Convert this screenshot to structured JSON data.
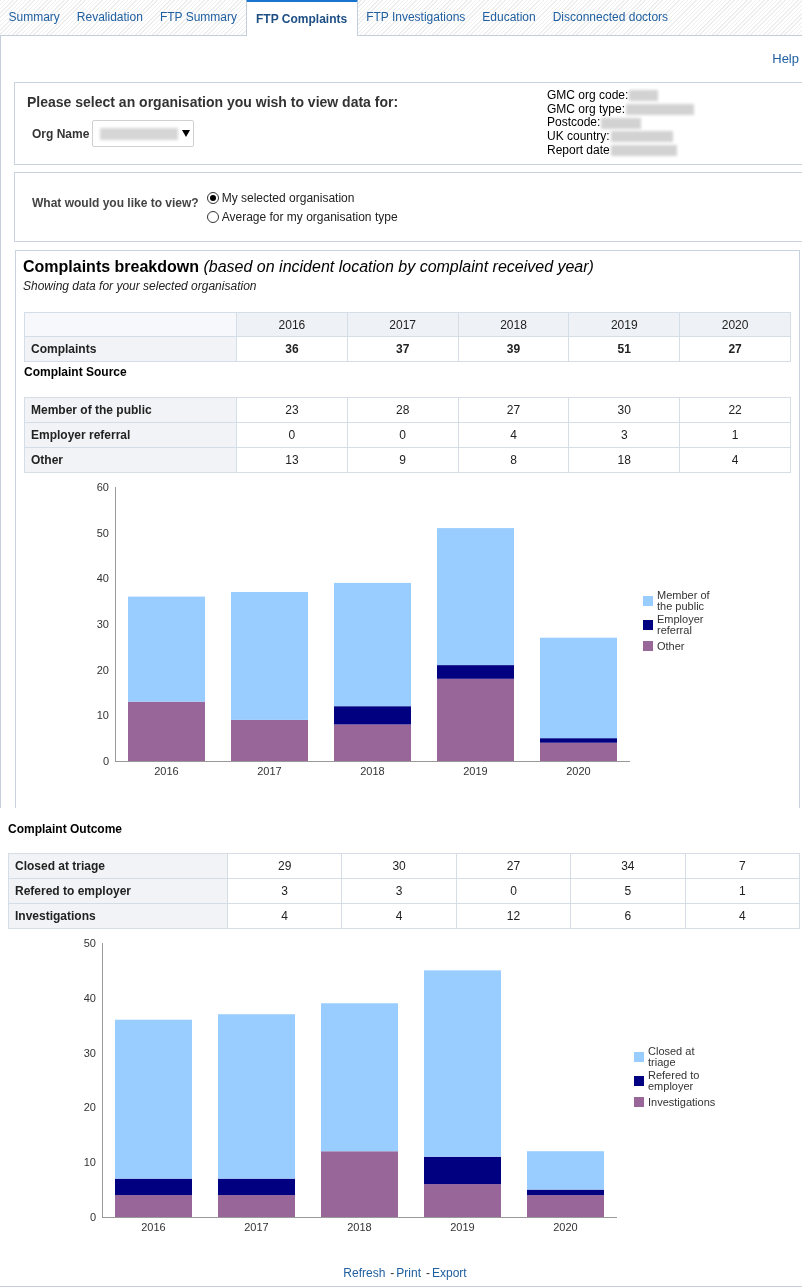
{
  "tabs": [
    {
      "label": "Summary",
      "selected": false
    },
    {
      "label": "Revalidation",
      "selected": false
    },
    {
      "label": "FTP Summary",
      "selected": false
    },
    {
      "label": "FTP Complaints",
      "selected": true
    },
    {
      "label": "FTP Investigations",
      "selected": false
    },
    {
      "label": "Education",
      "selected": false
    },
    {
      "label": "Disconnected doctors",
      "selected": false
    }
  ],
  "help_link": "Help",
  "organisation": {
    "prompt": "Please select an organisation you wish to view data for:",
    "org_name_label": "Org Name",
    "details": [
      "GMC org code:",
      "GMC org type:",
      "Postcode:",
      "UK country:",
      "Report date"
    ]
  },
  "view_selection": {
    "question": "What would you like to view?",
    "options": [
      {
        "label": "My selected organisation",
        "selected": true
      },
      {
        "label": "Average for my organisation type",
        "selected": false
      }
    ]
  },
  "complaints_breakdown": {
    "title": "**Complaints breakdown** *(based on incident location by complaint received year)*",
    "subtitle": "Showing data for your selected organisation",
    "years": [
      "2016",
      "2017",
      "2018",
      "2019",
      "2020"
    ],
    "total_row": {
      "label": "Complaints",
      "values": [
        "36",
        "37",
        "39",
        "51",
        "27"
      ]
    },
    "source_heading": "Complaint Source",
    "source_rows": [
      {
        "label": "Member of the public",
        "values": [
          "23",
          "28",
          "27",
          "30",
          "22"
        ]
      },
      {
        "label": "Employer referral",
        "values": [
          "0",
          "0",
          "4",
          "3",
          "1"
        ]
      },
      {
        "label": "Other",
        "values": [
          "13",
          "9",
          "8",
          "18",
          "4"
        ]
      }
    ],
    "chart_data": {
      "type": "bar",
      "stacked": true,
      "categories": [
        "2016",
        "2017",
        "2018",
        "2019",
        "2020"
      ],
      "series": [
        {
          "name": "Member of the public",
          "color": "#99ccff",
          "values": [
            23,
            28,
            27,
            30,
            22
          ]
        },
        {
          "name": "Employer referral",
          "color": "#000080",
          "values": [
            0,
            0,
            4,
            3,
            1
          ]
        },
        {
          "name": "Other",
          "color": "#996699",
          "values": [
            13,
            9,
            8,
            18,
            4
          ]
        }
      ],
      "ylim": [
        0,
        60
      ],
      "yticks": [
        0,
        10,
        20,
        30,
        40,
        50,
        60
      ],
      "legend": true
    }
  },
  "complaint_outcome": {
    "heading": "Complaint Outcome",
    "rows": [
      {
        "label": "Closed at triage",
        "values": [
          "29",
          "30",
          "27",
          "34",
          "7"
        ]
      },
      {
        "label": "Refered to employer",
        "values": [
          "3",
          "3",
          "0",
          "5",
          "1"
        ]
      },
      {
        "label": "Investigations",
        "values": [
          "4",
          "4",
          "12",
          "6",
          "4"
        ]
      }
    ],
    "chart_data": {
      "type": "bar",
      "stacked": true,
      "categories": [
        "2016",
        "2017",
        "2018",
        "2019",
        "2020"
      ],
      "series": [
        {
          "name": "Closed at triage",
          "color": "#99ccff",
          "values": [
            29,
            30,
            27,
            34,
            7
          ]
        },
        {
          "name": "Refered to employer",
          "color": "#000080",
          "values": [
            3,
            3,
            0,
            5,
            1
          ]
        },
        {
          "name": "Investigations",
          "color": "#996699",
          "values": [
            4,
            4,
            12,
            6,
            4
          ]
        }
      ],
      "ylim": [
        0,
        50
      ],
      "yticks": [
        0,
        10,
        20,
        30,
        40,
        50
      ],
      "legend": true
    }
  },
  "footer": [
    {
      "kind": "link",
      "text": "Refresh"
    },
    {
      "kind": "separator",
      "text": "-"
    },
    {
      "kind": "link",
      "text": "Print"
    },
    {
      "kind": "separator",
      "text": "-"
    },
    {
      "kind": "link",
      "text": "Export"
    }
  ]
}
